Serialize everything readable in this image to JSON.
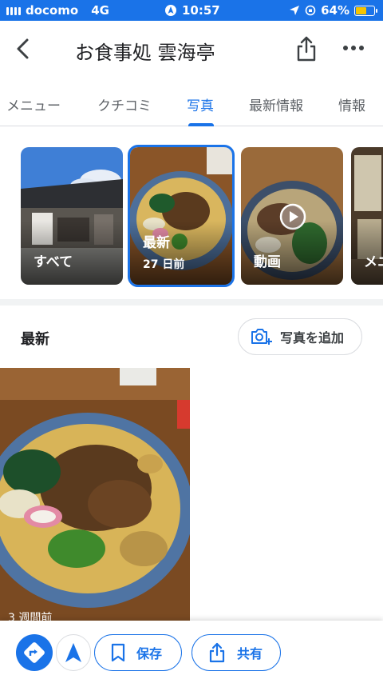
{
  "status": {
    "carrier": "docomo",
    "network": "4G",
    "time": "10:57",
    "battery": "64%",
    "battery_level": 0.64
  },
  "header": {
    "title": "お食事処 雲海亭"
  },
  "tabs": [
    {
      "label": "メニュー"
    },
    {
      "label": "クチコミ"
    },
    {
      "label": "写真"
    },
    {
      "label": "最新情報"
    },
    {
      "label": "情報"
    }
  ],
  "categories": [
    {
      "label": "すべて"
    },
    {
      "label": "最新",
      "sub": "27 日前"
    },
    {
      "label": "動画"
    },
    {
      "label": "メニ"
    }
  ],
  "latest": {
    "title": "最新",
    "add_photo": "写真を追加",
    "photo_age": "3 週間前"
  },
  "bottom": {
    "save": "保存",
    "share": "共有"
  },
  "colors": {
    "accent": "#1a73e8",
    "status_bar": "#1a73e8",
    "battery": "#f5c400"
  }
}
